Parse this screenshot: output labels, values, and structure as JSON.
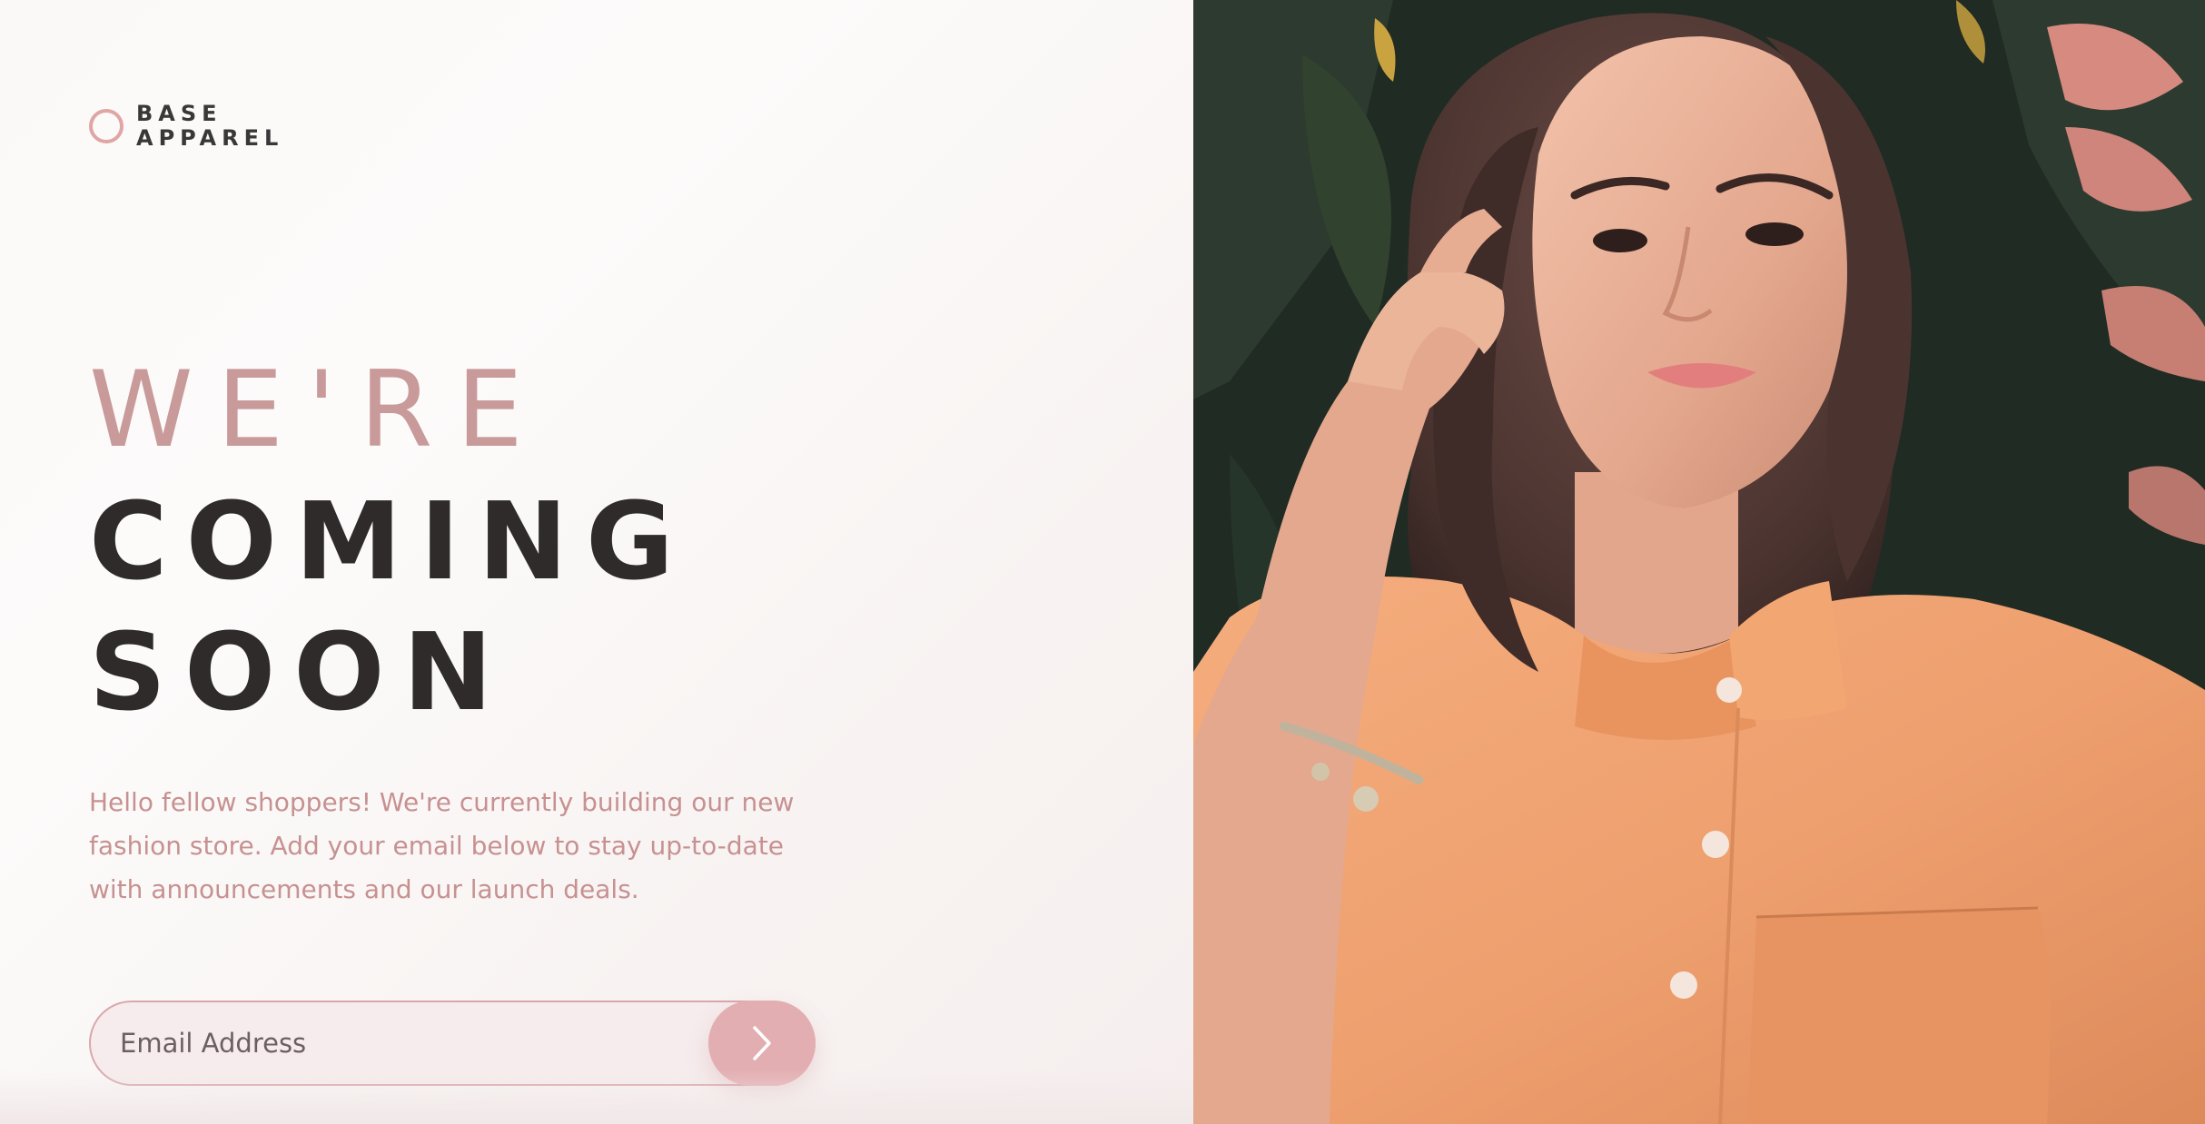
{
  "brand": {
    "line1": "BASE",
    "line2": "APPAREL"
  },
  "hero": {
    "headline_light": "WE'RE",
    "headline_line2": "COMING",
    "headline_line3": "SOON",
    "description": "Hello fellow shoppers! We're currently building our new fashion store. Add your email below to stay up-to-date with announcements and our launch deals."
  },
  "form": {
    "email_placeholder": "Email Address",
    "email_value": ""
  },
  "icons": {
    "logo": "circle-logo-icon",
    "submit": "chevron-right-icon"
  },
  "colors": {
    "accent": "#c99a9a",
    "button": "#e3aeb1",
    "dark_text": "#2f2b2b",
    "description_text": "#c79191"
  }
}
